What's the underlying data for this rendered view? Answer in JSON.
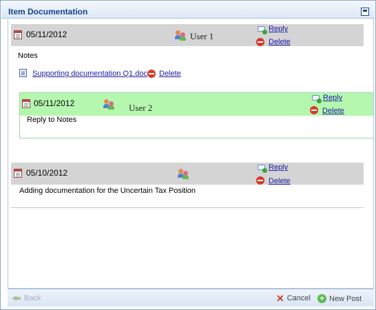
{
  "window": {
    "title": "Item Documentation"
  },
  "posts": [
    {
      "date": "05/11/2012",
      "user": "User 1",
      "reply_label": "Reply",
      "delete_label": "Delete",
      "body": "Notes",
      "attachment": {
        "name": "Supporting documentation Q1.doc",
        "delete_label": "Delete"
      },
      "replies": [
        {
          "date": "05/11/2012",
          "user": "User 2",
          "reply_label": "Reply",
          "delete_label": "Delete",
          "body": "Reply to Notes",
          "header_color": "#b6f7b0"
        }
      ]
    },
    {
      "date": "05/10/2012",
      "user": "",
      "reply_label": "Reply",
      "delete_label": "Delete",
      "body": "Adding documentation for the Uncertain Tax Position"
    }
  ],
  "footer": {
    "back_label": "Back",
    "cancel_label": "Cancel",
    "new_post_label": "New Post"
  },
  "icons": {
    "calendar": "calendar-icon",
    "users": "users-icon",
    "reply": "reply-icon",
    "delete": "delete-icon",
    "document": "document-icon",
    "back": "back-arrow-icon",
    "cancel": "cancel-x-icon",
    "new_post": "add-circle-icon"
  }
}
